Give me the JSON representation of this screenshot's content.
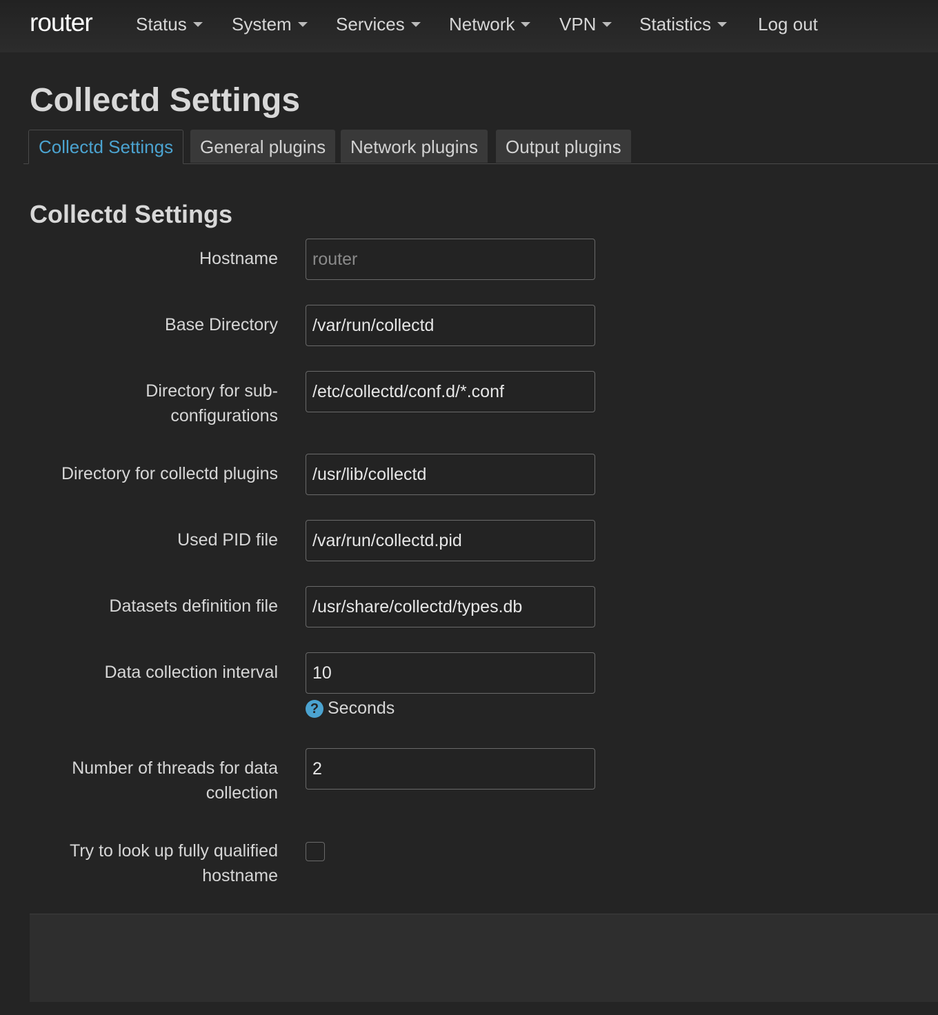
{
  "navbar": {
    "brand": "router",
    "items": [
      {
        "label": "Status"
      },
      {
        "label": "System"
      },
      {
        "label": "Services"
      },
      {
        "label": "Network"
      },
      {
        "label": "VPN"
      },
      {
        "label": "Statistics"
      }
    ],
    "logout": "Log out"
  },
  "page": {
    "title": "Collectd Settings"
  },
  "tabs": [
    {
      "label": "Collectd Settings",
      "active": true
    },
    {
      "label": "General plugins",
      "active": false
    },
    {
      "label": "Network plugins",
      "active": false
    },
    {
      "label": "Output plugins",
      "active": false
    }
  ],
  "section": {
    "title": "Collectd Settings"
  },
  "form": {
    "hostname": {
      "label": "Hostname",
      "value": "",
      "placeholder": "router"
    },
    "base_directory": {
      "label": "Base Directory",
      "value": "/var/run/collectd"
    },
    "subconfig_dir": {
      "label_line1": "Directory for sub-",
      "label_line2": "configurations",
      "value": "/etc/collectd/conf.d/*.conf"
    },
    "plugin_dir": {
      "label": "Directory for collectd plugins",
      "value": "/usr/lib/collectd"
    },
    "pid_file": {
      "label": "Used PID file",
      "value": "/var/run/collectd.pid"
    },
    "types_db": {
      "label": "Datasets definition file",
      "value": "/usr/share/collectd/types.db"
    },
    "interval": {
      "label": "Data collection interval",
      "value": "10",
      "help_icon": "?",
      "help": "Seconds"
    },
    "threads": {
      "label_line1": "Number of threads for data",
      "label_line2": "collection",
      "value": "2"
    },
    "fqdn_lookup": {
      "label_line1": "Try to look up fully qualified",
      "label_line2": "hostname",
      "checked": false
    }
  }
}
